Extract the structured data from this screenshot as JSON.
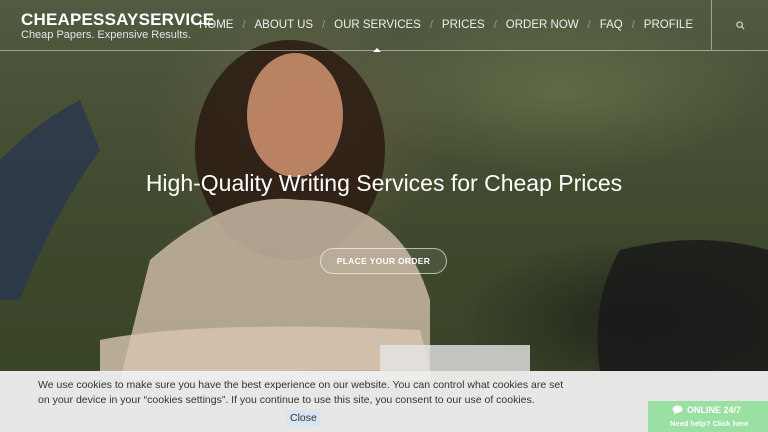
{
  "brand": {
    "title": "CHEAPESSAYSERVICE",
    "tagline": "Cheap Papers. Expensive Results."
  },
  "nav": {
    "items": [
      {
        "label": "HOME"
      },
      {
        "label": "ABOUT US"
      },
      {
        "label": "OUR SERVICES",
        "active": true
      },
      {
        "label": "PRICES"
      },
      {
        "label": "ORDER NOW"
      },
      {
        "label": "FAQ"
      },
      {
        "label": "PROFILE"
      }
    ],
    "separator": "/",
    "search_icon": "search-icon"
  },
  "hero": {
    "headline": "High-Quality Writing Services for Cheap Prices",
    "cta_label": "PLACE YOUR ORDER"
  },
  "cookie_banner": {
    "text": "We use cookies to make sure you have the best experience on our website. You can control what cookies are set on your device in your “cookies settings”. If you continue to use this site, you consent to our use of cookies.",
    "close_label": "Close"
  },
  "chat": {
    "status": "ONLINE 24/7",
    "prompt": "Need help? Click here",
    "icon": "chat-bubble-icon",
    "color": "#9be0a3"
  }
}
